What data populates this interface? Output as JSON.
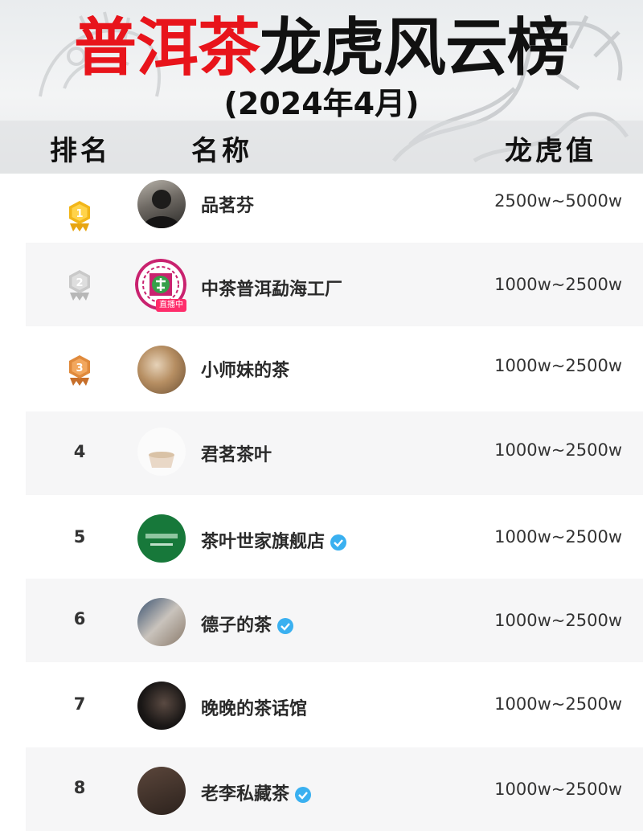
{
  "header": {
    "title_red": "普洱茶",
    "title_black": "龙虎风云榜",
    "subtitle": "(2024年4月)",
    "columns": {
      "rank": "排名",
      "name": "名称",
      "value": "龙虎值"
    }
  },
  "colors": {
    "title_red": "#e8141b",
    "verified": "#3ab0f0",
    "gold": "#f2b619",
    "silver": "#c9c9c9",
    "bronze": "#e08a3c"
  },
  "rows": [
    {
      "rank": "",
      "medal": "gold",
      "name": "品茗芬",
      "verified": false,
      "value": "2500w~5000w"
    },
    {
      "rank": "",
      "medal": "silver",
      "name": "中茶普洱勐海工厂",
      "verified": false,
      "value": "1000w~2500w",
      "avatar_badge": "直播中"
    },
    {
      "rank": "",
      "medal": "bronze",
      "name": "小师妹的茶",
      "verified": false,
      "value": "1000w~2500w"
    },
    {
      "rank": "4",
      "medal": "",
      "name": "君茗茶叶",
      "verified": false,
      "value": "1000w~2500w"
    },
    {
      "rank": "5",
      "medal": "",
      "name": "茶叶世家旗舰店",
      "verified": true,
      "value": "1000w~2500w"
    },
    {
      "rank": "6",
      "medal": "",
      "name": "德子的茶",
      "verified": true,
      "value": "1000w~2500w"
    },
    {
      "rank": "7",
      "medal": "",
      "name": "晚晚的茶话馆",
      "verified": false,
      "value": "1000w~2500w"
    },
    {
      "rank": "8",
      "medal": "",
      "name": "老李私藏茶",
      "verified": true,
      "value": "1000w~2500w"
    }
  ]
}
